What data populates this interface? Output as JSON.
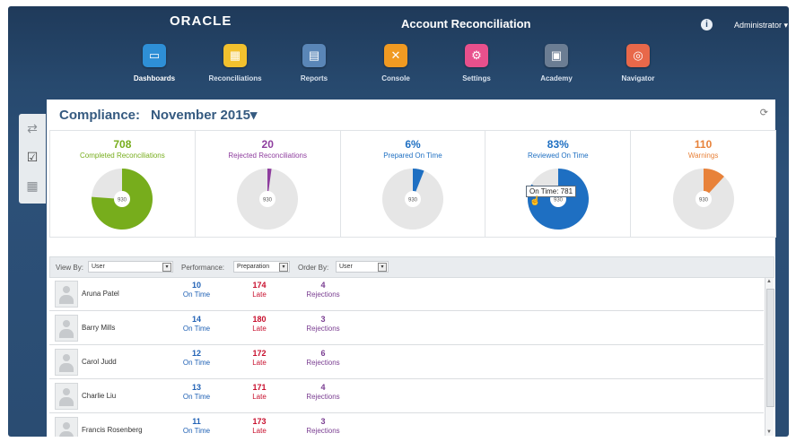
{
  "header": {
    "logo": "ORACLE",
    "title": "Account Reconciliation",
    "user": "Administrator ▾"
  },
  "nav": [
    {
      "label": "Dashboards",
      "color": "#2e8fd6",
      "icon": "monitor-icon"
    },
    {
      "label": "Reconciliations",
      "color": "#f2c12e",
      "icon": "grid-icon"
    },
    {
      "label": "Reports",
      "color": "#5a86b7",
      "icon": "report-icon"
    },
    {
      "label": "Console",
      "color": "#f09a22",
      "icon": "tools-icon"
    },
    {
      "label": "Settings",
      "color": "#e8508c",
      "icon": "settings-icon"
    },
    {
      "label": "Academy",
      "color": "#6b7d93",
      "icon": "academy-icon"
    },
    {
      "label": "Navigator",
      "color": "#e8684a",
      "icon": "compass-icon"
    }
  ],
  "compliance": {
    "label": "Compliance:",
    "period": "November 2015▾"
  },
  "kpis": [
    {
      "value": "708",
      "label": "Completed Reconciliations",
      "color": "#77ad1c",
      "fraction": 0.761,
      "center": "930"
    },
    {
      "value": "20",
      "label": "Rejected Reconciliations",
      "color": "#8e3d9e",
      "fraction": 0.0215,
      "center": "930"
    },
    {
      "value": "6%",
      "label": "Prepared On Time",
      "color": "#1e6fc2",
      "fraction": 0.06,
      "center": "930"
    },
    {
      "value": "83%",
      "label": "Reviewed On Time",
      "color": "#1e6fc2",
      "fraction": 0.83,
      "center": "930"
    },
    {
      "value": "110",
      "label": "Warnings",
      "color": "#e8823a",
      "fraction": 0.118,
      "center": "930"
    }
  ],
  "tooltip": "On Time: 781",
  "filters": {
    "view_by_label": "View By:",
    "view_by_value": "User",
    "performance_label": "Performance:",
    "performance_value": "Preparation",
    "order_by_label": "Order By:",
    "order_by_value": "User"
  },
  "rows": [
    {
      "name": "Aruna Patel",
      "ontime": "10",
      "late": "174",
      "rejections": "4"
    },
    {
      "name": "Barry Mills",
      "ontime": "14",
      "late": "180",
      "rejections": "3"
    },
    {
      "name": "Carol Judd",
      "ontime": "12",
      "late": "172",
      "rejections": "6"
    },
    {
      "name": "Charlie Liu",
      "ontime": "13",
      "late": "171",
      "rejections": "4"
    },
    {
      "name": "Francis Rosenberg",
      "ontime": "11",
      "late": "173",
      "rejections": "3"
    }
  ],
  "labels": {
    "ontime": "On Time",
    "late": "Late",
    "rejections": "Rejections"
  }
}
